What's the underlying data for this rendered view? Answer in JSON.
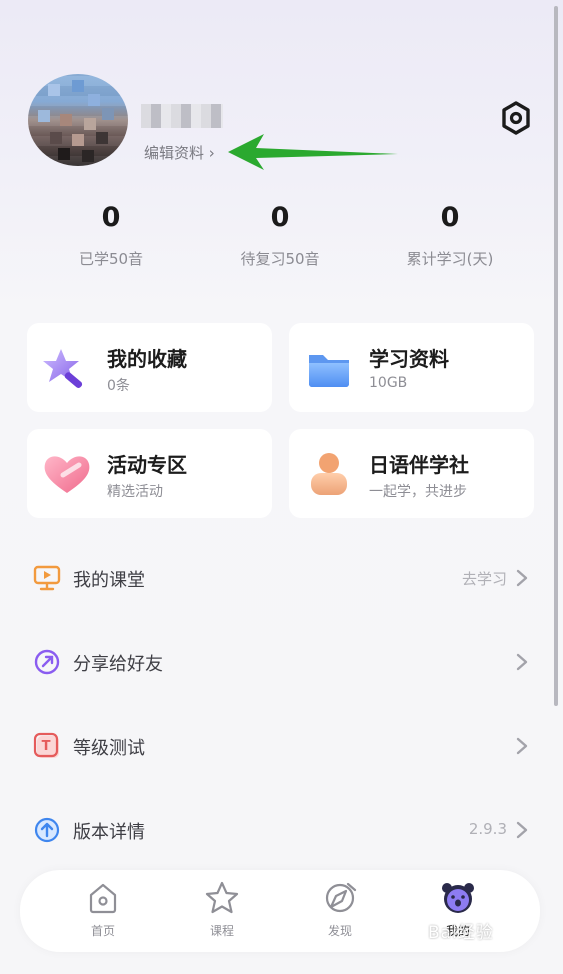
{
  "profile": {
    "edit_label": "编辑资料 ›"
  },
  "stats": [
    {
      "value": "0",
      "label": "已学50音"
    },
    {
      "value": "0",
      "label": "待复习50音"
    },
    {
      "value": "0",
      "label": "累计学习(天)"
    }
  ],
  "cards": [
    {
      "title": "我的收藏",
      "subtitle": "0条",
      "icon": "star-wand-icon"
    },
    {
      "title": "学习资料",
      "subtitle": "10GB",
      "icon": "folder-icon"
    },
    {
      "title": "活动专区",
      "subtitle": "精选活动",
      "icon": "heart-icon"
    },
    {
      "title": "日语伴学社",
      "subtitle": "一起学，共进步",
      "icon": "person-icon"
    }
  ],
  "menu": [
    {
      "label": "我的课堂",
      "right": "去学习",
      "icon": "classroom-icon"
    },
    {
      "label": "分享给好友",
      "right": "",
      "icon": "share-icon"
    },
    {
      "label": "等级测试",
      "right": "",
      "icon": "test-icon"
    },
    {
      "label": "版本详情",
      "right": "2.9.3",
      "icon": "upgrade-icon"
    }
  ],
  "tabs": [
    {
      "label": "首页",
      "icon": "home-icon"
    },
    {
      "label": "课程",
      "icon": "star-icon"
    },
    {
      "label": "发现",
      "icon": "compass-icon"
    },
    {
      "label": "我的",
      "icon": "bear-icon"
    }
  ],
  "watermark": "Bai经验",
  "colors": {
    "accent_green": "#2ba92f",
    "background": "#f6f6f9",
    "card": "#ffffff"
  }
}
